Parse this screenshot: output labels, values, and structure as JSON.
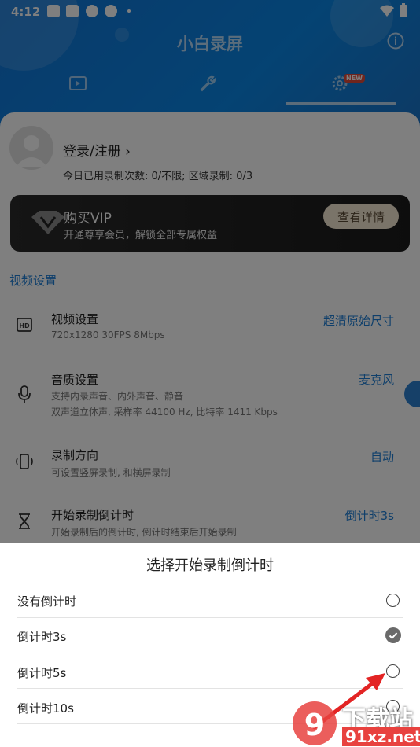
{
  "status_bar": {
    "time": "4:12"
  },
  "app": {
    "title": "小白录屏",
    "badge_new": "NEW"
  },
  "account": {
    "login_label": "登录/注册",
    "stats": "今日已用录制次数: 0/不限; 区域录制: 0/3"
  },
  "vip": {
    "title": "购买VIP",
    "subtitle": "开通尊享会员，解锁全部专属权益",
    "button": "查看详情"
  },
  "settings": {
    "section_title": "视频设置",
    "rows": [
      {
        "title": "视频设置",
        "sub": "720x1280  30FPS  8Mbps",
        "value": "超清原始尺寸"
      },
      {
        "title": "音质设置",
        "sub": "支持内录声音、内外声音、静音",
        "sub2": "双声道立体声, 采样率 44100 Hz, 比特率 1411 Kbps",
        "value": "麦克风"
      },
      {
        "title": "录制方向",
        "sub": "可设置竖屏录制, 和横屏录制",
        "value": "自动"
      },
      {
        "title": "开始录制倒计时",
        "sub": "开始录制后的倒计时, 倒计时结束后开始录制",
        "value": "倒计时3s"
      }
    ]
  },
  "dialog": {
    "title": "选择开始录制倒计时",
    "options": [
      {
        "label": "没有倒计时",
        "selected": false
      },
      {
        "label": "倒计时3s",
        "selected": true
      },
      {
        "label": "倒计时5s",
        "selected": false
      },
      {
        "label": "倒计时10s",
        "selected": false
      }
    ]
  },
  "watermark": {
    "text": "下载站",
    "url": "91xz.net"
  },
  "colors": {
    "accent": "#1e7fd6",
    "header": "#1176d8"
  }
}
